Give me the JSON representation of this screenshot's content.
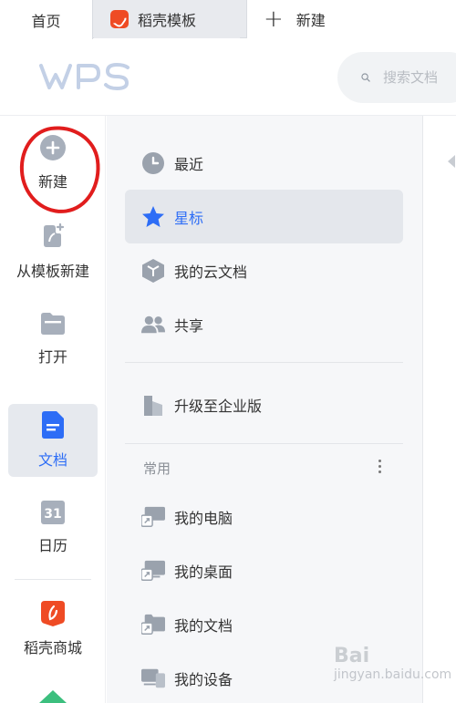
{
  "tabs": [
    {
      "label": "首页",
      "active": true
    },
    {
      "label": "稻壳模板",
      "icon": "daoke-icon"
    },
    {
      "label": "新建",
      "icon": "plus-icon"
    }
  ],
  "header": {
    "logo_text": "WPS",
    "search_placeholder": "搜索文档"
  },
  "rail": {
    "items": [
      {
        "label": "新建",
        "icon": "plus-circle-icon",
        "annotated": true
      },
      {
        "label": "从模板新建",
        "icon": "template-icon"
      },
      {
        "label": "打开",
        "icon": "folder-icon"
      },
      {
        "label": "文档",
        "icon": "document-icon",
        "active": true
      },
      {
        "label": "日历",
        "icon": "calendar-icon",
        "calendar_day": "31"
      },
      {
        "label": "稻壳商城",
        "icon": "daoke-store-icon"
      }
    ]
  },
  "nav": {
    "items": [
      {
        "label": "最近",
        "icon": "clock-icon"
      },
      {
        "label": "星标",
        "icon": "star-icon",
        "active": true
      },
      {
        "label": "我的云文档",
        "icon": "cloud-doc-icon"
      },
      {
        "label": "共享",
        "icon": "people-icon"
      },
      {
        "label": "升级至企业版",
        "icon": "enterprise-icon"
      }
    ],
    "section_label": "常用",
    "common": [
      {
        "label": "我的电脑",
        "icon": "computer-shortcut-icon"
      },
      {
        "label": "我的桌面",
        "icon": "desktop-shortcut-icon"
      },
      {
        "label": "我的文档",
        "icon": "folder-shortcut-icon"
      },
      {
        "label": "我的设备",
        "icon": "devices-icon"
      }
    ]
  },
  "watermark": {
    "big": "Bai",
    "small": "jingyan.baidu.com"
  },
  "colors": {
    "accent": "#2d6df6",
    "annotation": "#e11d1d",
    "brand_orange": "#ef4b24",
    "icon_gray": "#9aa2ad"
  }
}
